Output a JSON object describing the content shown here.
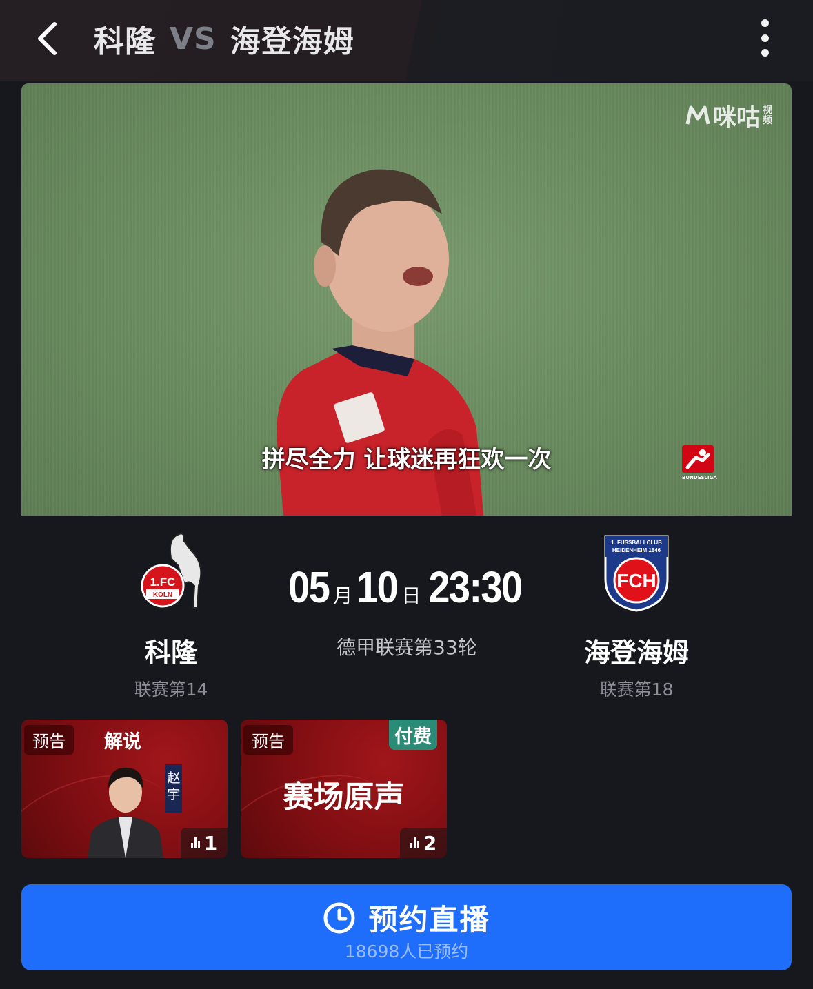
{
  "header": {
    "home_team": "科隆",
    "vs": "VS",
    "away_team": "海登海姆"
  },
  "video": {
    "watermark_brand": "咪咕",
    "watermark_small_1": "视",
    "watermark_small_2": "频",
    "subtitle": "拼尽全力 让球迷再狂欢一次",
    "league_logo_text": "BUNDESLIGA"
  },
  "match": {
    "month": "05",
    "month_unit": "月",
    "day": "10",
    "day_unit": "日",
    "time": "23:30",
    "round": "德甲联赛第33轮",
    "home": {
      "name": "科隆",
      "rank": "联赛第14",
      "logo_text": "1.FC",
      "logo_sub": "KÖLN"
    },
    "away": {
      "name": "海登海姆",
      "rank": "联赛第18",
      "logo_text": "FCH",
      "logo_top_1": "1. FUSSBALLCLUB",
      "logo_top_2": "HEIDENHEIM 1846"
    }
  },
  "cards": [
    {
      "tag": "预告",
      "label": "解说",
      "commentator": "赵宇",
      "count": "1"
    },
    {
      "tag": "预告",
      "label": "赛场原声",
      "badge": "付费",
      "count": "2"
    }
  ],
  "reserve": {
    "label": "预约直播",
    "sub": "18698人已预约"
  },
  "colors": {
    "accent_blue": "#1e6dfb",
    "card_red": "#8c1014",
    "paid_green": "#2a8c77",
    "background": "#16181d"
  }
}
